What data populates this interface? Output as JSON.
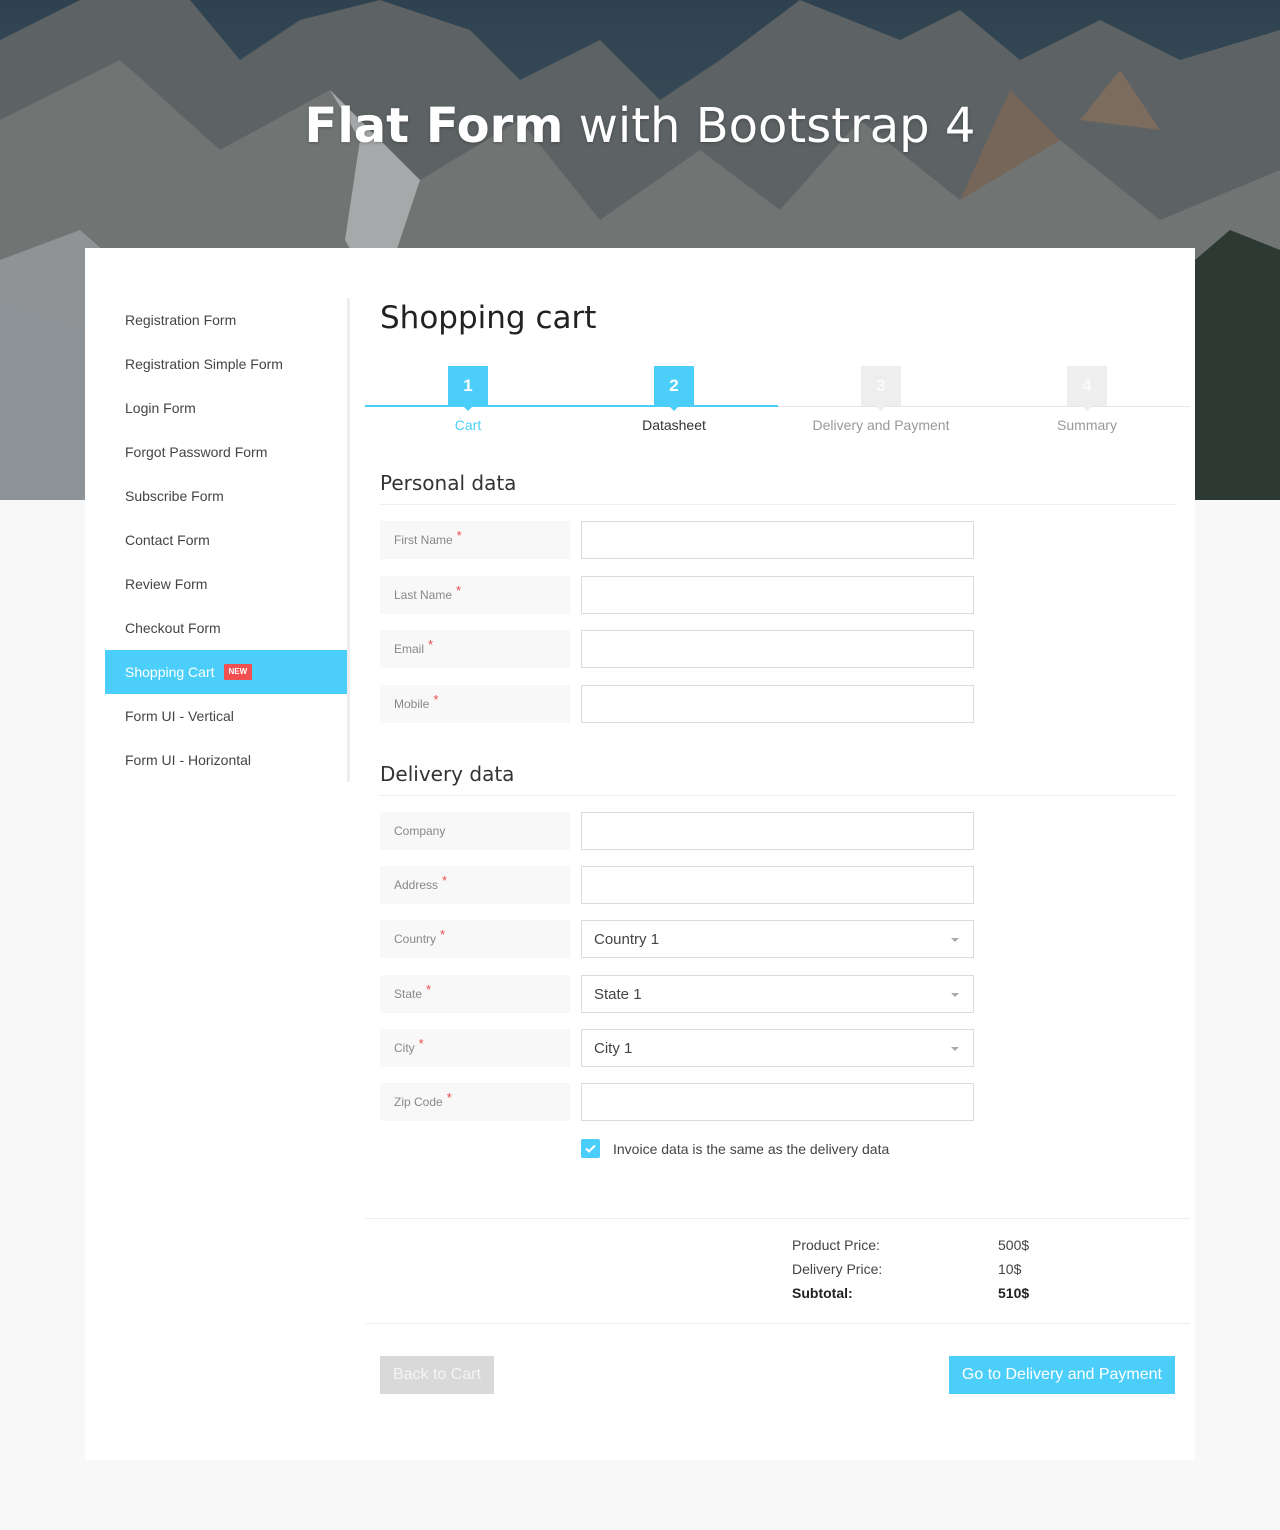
{
  "hero": {
    "title_bold": "Flat Form",
    "title_light": "with Bootstrap 4"
  },
  "sidebar": {
    "items": [
      {
        "label": "Registration Form"
      },
      {
        "label": "Registration Simple Form"
      },
      {
        "label": "Login Form"
      },
      {
        "label": "Forgot Password Form"
      },
      {
        "label": "Subscribe Form"
      },
      {
        "label": "Contact Form"
      },
      {
        "label": "Review Form"
      },
      {
        "label": "Checkout Form"
      },
      {
        "label": "Shopping Cart",
        "badge": "NEW"
      },
      {
        "label": "Form UI - Vertical"
      },
      {
        "label": "Form UI - Horizontal"
      }
    ]
  },
  "main": {
    "title": "Shopping cart",
    "steps": [
      {
        "num": "1",
        "label": "Cart"
      },
      {
        "num": "2",
        "label": "Datasheet"
      },
      {
        "num": "3",
        "label": "Delivery and Payment"
      },
      {
        "num": "4",
        "label": "Summary"
      }
    ],
    "personal": {
      "title": "Personal data",
      "fields": [
        {
          "label": "First Name",
          "required": "*",
          "value": ""
        },
        {
          "label": "Last Name",
          "required": "*",
          "value": ""
        },
        {
          "label": "Email",
          "required": "*",
          "value": ""
        },
        {
          "label": "Mobile",
          "required": "*",
          "value": ""
        }
      ]
    },
    "delivery": {
      "title": "Delivery data",
      "fields": [
        {
          "label": "Company",
          "required": "",
          "value": ""
        },
        {
          "label": "Address",
          "required": "*",
          "value": ""
        },
        {
          "label": "Country",
          "required": "*",
          "value": "Country 1"
        },
        {
          "label": "State",
          "required": "*",
          "value": "State 1"
        },
        {
          "label": "City",
          "required": "*",
          "value": "City 1"
        },
        {
          "label": "Zip Code",
          "required": "*",
          "value": ""
        }
      ],
      "invoice_checkbox_label": "Invoice data is the same as the delivery data"
    },
    "totals": {
      "product_price_label": "Product Price:",
      "product_price_value": "500$",
      "delivery_price_label": "Delivery Price:",
      "delivery_price_value": "10$",
      "subtotal_label": "Subtotal:",
      "subtotal_value": "510$"
    },
    "buttons": {
      "back": "Back to Cart",
      "next": "Go to Delivery and Payment"
    }
  },
  "colors": {
    "accent": "#4bcffa",
    "badge": "#f0504f",
    "required": "#e84c4c"
  }
}
